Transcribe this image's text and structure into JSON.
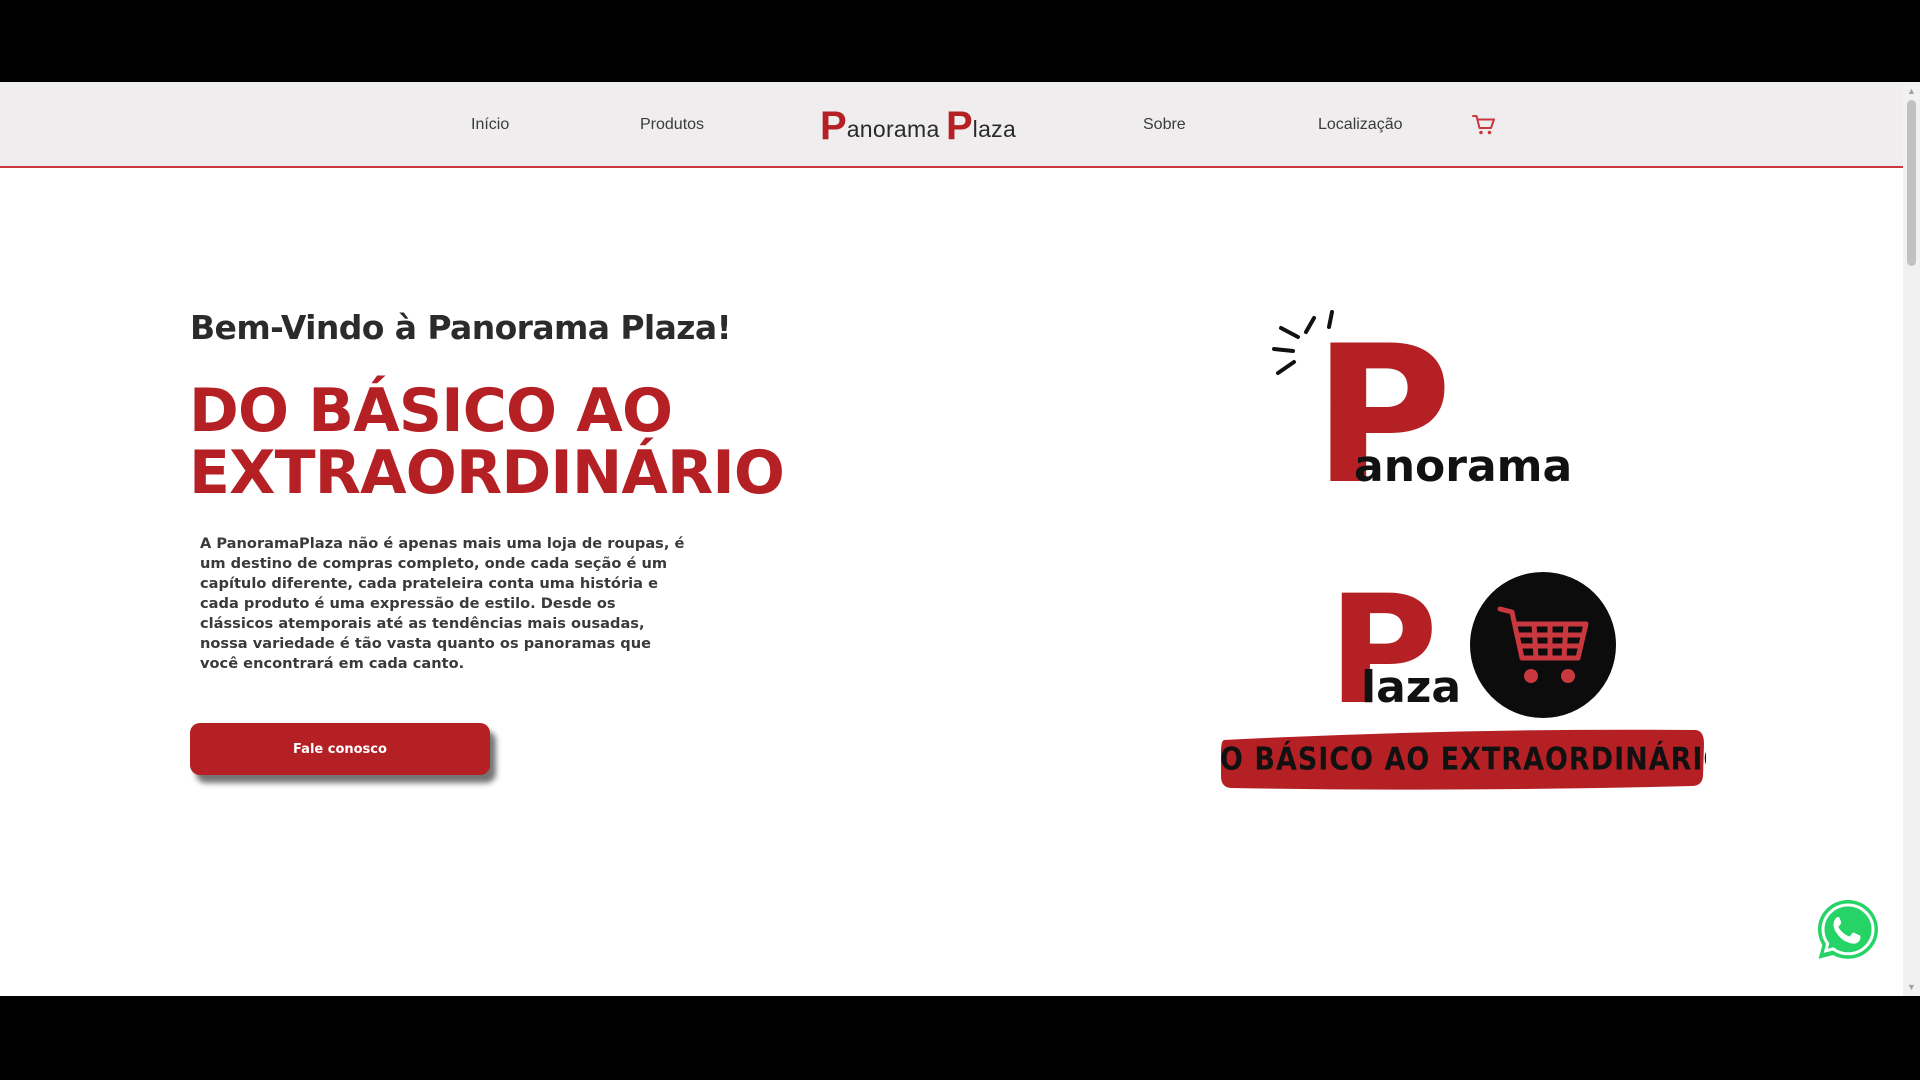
{
  "nav": {
    "inicio": "Início",
    "produtos": "Produtos",
    "brand_p1": "P",
    "brand_w1": "anorama",
    "brand_p2": "P",
    "brand_w2": "laza",
    "sobre": "Sobre",
    "localizacao": "Localização",
    "cart_icon": "cart-icon"
  },
  "hero": {
    "welcome": "Bem-Vindo à Panorama Plaza!",
    "headline_line1": "DO BÁSICO AO",
    "headline_line2": "EXTRAORDINÁRIO",
    "description": "A PanoramaPlaza não é apenas mais uma loja de roupas, é um destino de compras completo, onde cada seção é um capítulo diferente, cada prateleira conta uma história e cada produto é uma expressão de estilo. Desde os clássicos atemporais até as tendências mais ousadas, nossa variedade é tão vasta quanto os panoramas que você encontrará em cada canto.",
    "cta": "Fale conosco"
  },
  "logo": {
    "word1": "anorama",
    "word2": "laza",
    "letter": "P",
    "banner": "DO BÁSICO AO EXTRAORDINÁRIO"
  },
  "icons": {
    "whatsapp": "whatsapp-icon"
  },
  "colors": {
    "brand_red": "#b52025",
    "nav_bg": "#efeded",
    "nav_border": "#c9383f",
    "text_dark": "#2b2b2b",
    "whatsapp_green": "#25d366"
  }
}
